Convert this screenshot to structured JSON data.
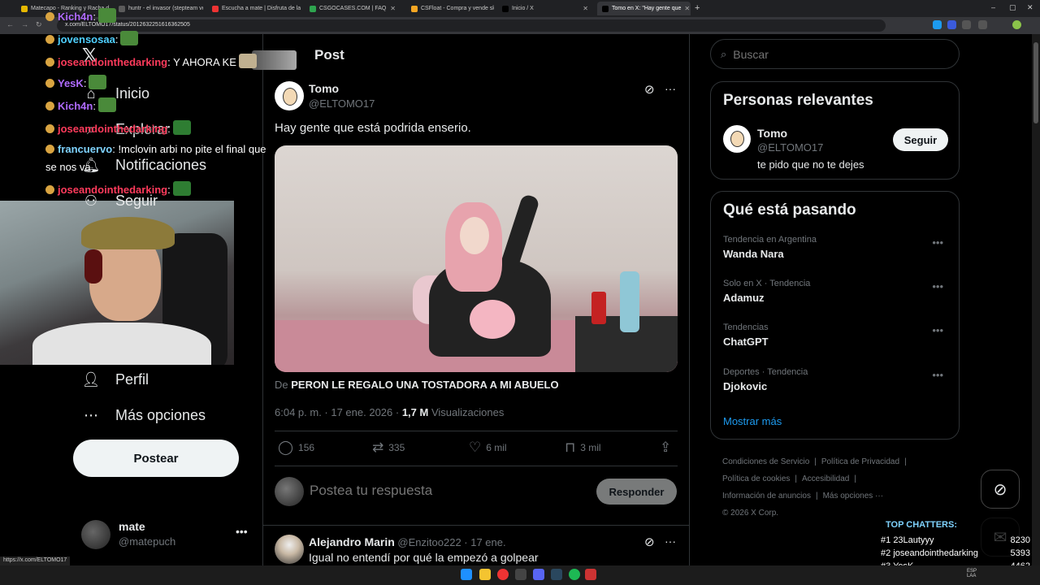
{
  "browser": {
    "tabs": [
      {
        "label": "Matecapo - Ranking y Racha d",
        "color": "#e6b800"
      },
      {
        "label": "huntr - el invasor (stepteam ve",
        "color": "#5b5b5b"
      },
      {
        "label": "Escucha a mate | Disfruta de la",
        "color": "#e33"
      },
      {
        "label": "CSGOCASES.COM | FAQ",
        "color": "#2ea44f"
      },
      {
        "label": "CSFloat - Compra y vende skins",
        "color": "#f5a623"
      },
      {
        "label": "Inicio / X",
        "color": "#000"
      },
      {
        "label": "Tomo en X: \"Hay gente que",
        "color": "#000"
      }
    ],
    "url": "x.com/ELTOMO17/status/2012632251616362505",
    "status_url": "https://x.com/ELTOMO17"
  },
  "nav": {
    "items": [
      {
        "label": "Inicio",
        "icon": "home-icon"
      },
      {
        "label": "Explorar",
        "icon": "search-icon"
      },
      {
        "label": "Notificaciones",
        "icon": "bell-icon"
      },
      {
        "label": "Seguir",
        "icon": "add-user-icon"
      },
      {
        "label": "Perfil",
        "icon": "person-icon"
      },
      {
        "label": "Más opciones",
        "icon": "more-circle-icon"
      }
    ],
    "post_button": "Postear",
    "account": {
      "name": "mate",
      "handle": "@matepuch"
    }
  },
  "chat": [
    {
      "user": "Kich4n",
      "sep": ":",
      "msg": "",
      "color": "#b06bff"
    },
    {
      "user": "jovensosaa",
      "sep": ":",
      "msg": "",
      "color": "#4fd0ff"
    },
    {
      "user": "joseandointhedarking",
      "sep": ":",
      "msg": " Y AHORA KE",
      "color": "#ff3b5c"
    },
    {
      "user": "YesK",
      "sep": ":",
      "msg": "",
      "color": "#b06bff"
    },
    {
      "user": "Kich4n",
      "sep": ":",
      "msg": "",
      "color": "#b06bff"
    },
    {
      "user": "joseandointhedarking",
      "sep": ":",
      "msg": "",
      "color": "#ff3b5c"
    },
    {
      "user": "francuervo",
      "sep": ":",
      "msg": " !mclovin arbi no pite el final que",
      "color": "#7fd3ff"
    },
    {
      "user": "",
      "sep": "",
      "msg": "se nos va",
      "color": "#ffffff"
    },
    {
      "user": "joseandointhedarking",
      "sep": ":",
      "msg": "",
      "color": "#ff3b5c"
    }
  ],
  "post": {
    "header": "Post",
    "author_name": "Tomo",
    "author_handle": "@ELTOMO17",
    "text": "Hay gente que está podrida enserio.",
    "source_prefix": "De ",
    "source_title": "PERON LE REGALO UNA TOSTADORA A MI ABUELO",
    "time": "6:04 p. m. · 17 ene. 2026 · ",
    "views_count": "1,7 M",
    "views_label": " Visualizaciones",
    "replies": "156",
    "reposts": "335",
    "likes": "6 mil",
    "bookmarks": "3 mil",
    "reply_placeholder": "Postea tu respuesta",
    "reply_button": "Responder"
  },
  "reply": {
    "name": "Alejandro Marin",
    "handle": "@Enzitoo222",
    "date": " · 17 ene.",
    "text": "Igual no entendí por qué la empezó a golpear"
  },
  "sidebar": {
    "search_placeholder": "Buscar",
    "relevant_title": "Personas relevantes",
    "relevant": {
      "name": "Tomo",
      "handle": "@ELTOMO17",
      "bio": "te pido que no te dejes",
      "follow": "Seguir"
    },
    "trending_title": "Qué está pasando",
    "trends": [
      {
        "context": "Tendencia en Argentina",
        "title": "Wanda Nara"
      },
      {
        "context": "Solo en X · Tendencia",
        "title": "Adamuz"
      },
      {
        "context": "Tendencias",
        "title": "ChatGPT"
      },
      {
        "context": "Deportes · Tendencia",
        "title": "Djokovic"
      }
    ],
    "show_more": "Mostrar más",
    "footer": [
      "Condiciones de Servicio",
      "|",
      "Política de Privacidad",
      "|",
      "Política de cookies",
      "|",
      "Accesibilidad",
      "|",
      "Información de anuncios",
      "|",
      "Más opciones ···",
      "© 2026 X Corp."
    ]
  },
  "top_chatters": {
    "title": "TOP CHATTERS:",
    "rows": [
      {
        "rank": "#1",
        "name": "23Lautyyy",
        "count": "8230"
      },
      {
        "rank": "#2",
        "name": "joseandointhedarking",
        "count": "5393"
      },
      {
        "rank": "#3",
        "name": "YesK",
        "count": "4462"
      }
    ]
  },
  "tray": {
    "lang": "ESP",
    "region": "LAA"
  }
}
